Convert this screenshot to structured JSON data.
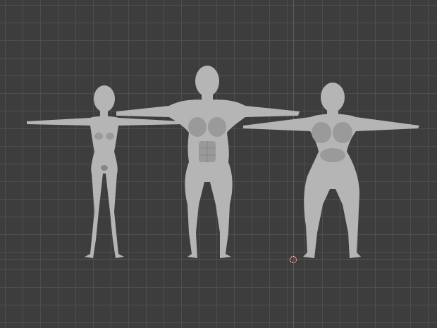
{
  "viewport": {
    "background": "#3d3d3d",
    "grid_color": "#505050",
    "axis_x_color": "#8a3f48",
    "axis_y_color": "#4a5e87"
  },
  "figures": [
    {
      "name": "slim-base-mesh",
      "icon": "human-figure-icon"
    },
    {
      "name": "muscular-base-mesh",
      "icon": "human-figure-icon"
    },
    {
      "name": "curvy-base-mesh",
      "icon": "human-figure-icon"
    }
  ],
  "cursor": {
    "icon": "3d-cursor-icon"
  }
}
